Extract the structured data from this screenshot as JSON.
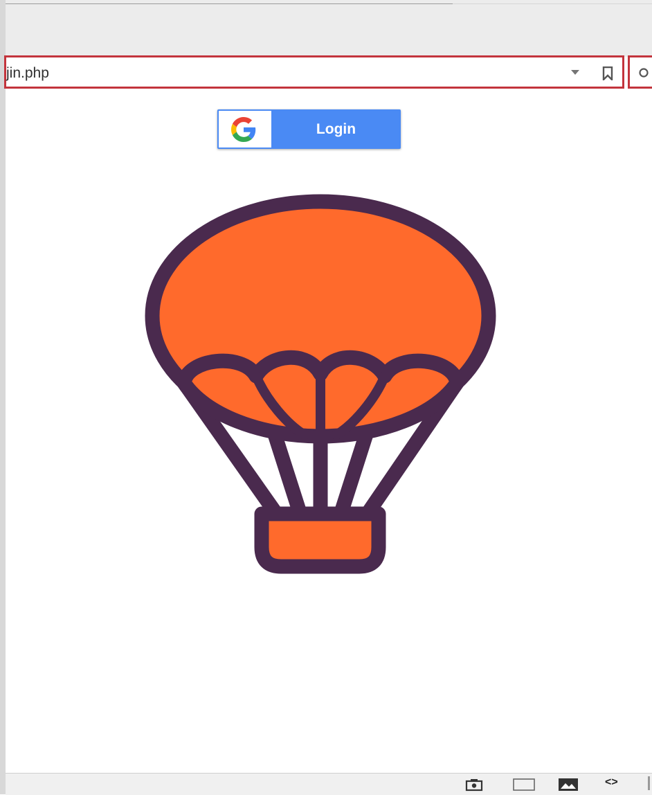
{
  "browser": {
    "url_fragment": "jin.php"
  },
  "login_button": {
    "label": "Login",
    "icon": "google-g-icon"
  },
  "illustration": {
    "name": "hot-air-balloon-icon",
    "colors": {
      "fill": "#ff6a2c",
      "stroke": "#4a2a4e"
    }
  },
  "status_bar": {
    "icons": [
      "camera-icon",
      "rectangle-icon",
      "image-icon",
      "code-icon"
    ],
    "code_glyph": "<>"
  },
  "colors": {
    "highlight_border": "#c3343c",
    "button_blue": "#4a8af4"
  }
}
